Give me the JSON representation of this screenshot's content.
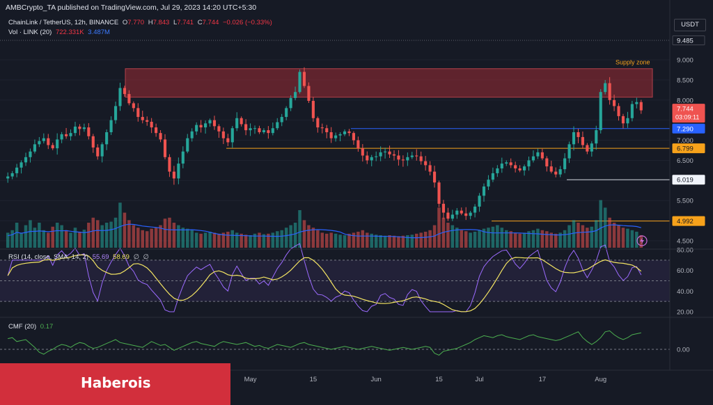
{
  "header": {
    "publisher": "AMBCrypto_TA published on TradingView.com, Jul 29, 2023 14:20 UTC+5:30",
    "symbol": "ChainLink / TetherUS, 12h, BINANCE",
    "ohlc": {
      "open_label": "O",
      "open": "7.770",
      "high_label": "H",
      "high": "7.843",
      "low_label": "L",
      "low": "7.741",
      "close_label": "C",
      "close": "7.744",
      "change": "−0.026 (−0.33%)"
    },
    "volume_legend": {
      "label": "Vol · LINK (20)",
      "value": "722.331K",
      "ma": "3.487M"
    },
    "currency": "USDT"
  },
  "rsi_legend": {
    "label": "RSI (14, close, SMA, 14, 2)",
    "rsi": "55.69",
    "sma": "58.69",
    "extra1": "∅",
    "extra2": "∅"
  },
  "cmf_legend": {
    "label": "CMF (20)",
    "value": "0.17"
  },
  "watermark": "Haberois",
  "colors": {
    "background": "#161a25",
    "up": "#26a69a",
    "down": "#ef5350",
    "supply_zone": "#9c2c35",
    "level_blue": "#2962ff",
    "level_orange": "#f7a21b",
    "level_white": "#d1d4dc",
    "rsi_line": "#9c6bff",
    "rsi_sma": "#f5e663",
    "cmf_line": "#4caf50",
    "volume_ma": "#2962ff",
    "watermark_bar": "#d22f3c"
  },
  "chart_data": [
    {
      "type": "candlestick",
      "title": "ChainLink / TetherUS, 12h, BINANCE",
      "interval": "12h",
      "ylim": [
        4.38,
        9.6
      ],
      "y_ticks": [
        "9.000",
        "8.500",
        "8.000",
        "7.500",
        "7.000",
        "6.500",
        "6.000",
        "5.500",
        "5.000",
        "4.500"
      ],
      "x_ticks": [
        "Apr",
        "17",
        "May",
        "15",
        "Jun",
        "15",
        "Jul",
        "17",
        "Aug"
      ],
      "price_labels": [
        {
          "value": "9.485",
          "style": "plain"
        },
        {
          "value": "7.744",
          "countdown": "03:09:11",
          "style": "last-price"
        },
        {
          "value": "7.290",
          "style": "blue"
        },
        {
          "value": "6.799",
          "style": "orange"
        },
        {
          "value": "6.019",
          "style": "white"
        },
        {
          "value": "4.992",
          "style": "orange"
        }
      ],
      "supply_zone": {
        "label": "Supply zone",
        "low": 8.07,
        "high": 8.78
      },
      "levels": [
        {
          "value": 7.29,
          "color": "blue"
        },
        {
          "value": 6.799,
          "color": "orange"
        },
        {
          "value": 6.019,
          "color": "white"
        },
        {
          "value": 4.992,
          "color": "orange"
        }
      ],
      "close_path": [
        6.1,
        6.18,
        6.32,
        6.45,
        6.58,
        6.72,
        6.9,
        6.98,
        7.05,
        6.88,
        6.8,
        7.02,
        7.15,
        7.1,
        7.18,
        7.34,
        7.28,
        7.32,
        7.1,
        6.82,
        6.6,
        6.9,
        7.2,
        7.5,
        7.85,
        8.3,
        8.15,
        7.92,
        7.8,
        7.58,
        7.5,
        7.46,
        7.32,
        7.18,
        7.02,
        6.58,
        6.22,
        6.05,
        6.42,
        6.72,
        7.05,
        7.22,
        7.38,
        7.32,
        7.42,
        7.5,
        7.35,
        7.22,
        7.05,
        6.95,
        7.3,
        7.55,
        7.4,
        7.25,
        7.3,
        7.3,
        7.2,
        7.25,
        7.18,
        7.3,
        7.45,
        7.58,
        7.8,
        8.05,
        8.2,
        8.7,
        8.35,
        7.98,
        7.55,
        7.32,
        7.3,
        7.2,
        7.05,
        7.12,
        7.15,
        7.22,
        7.18,
        7.0,
        6.8,
        6.62,
        6.5,
        6.58,
        6.6,
        6.7,
        6.72,
        6.65,
        6.62,
        6.52,
        6.5,
        6.58,
        6.62,
        6.6,
        6.48,
        6.38,
        6.22,
        5.95,
        5.42,
        5.2,
        5.05,
        5.15,
        5.25,
        5.18,
        5.12,
        5.2,
        5.35,
        5.62,
        5.85,
        6.02,
        6.18,
        6.3,
        6.42,
        6.45,
        6.38,
        6.3,
        6.25,
        6.35,
        6.5,
        6.6,
        6.7,
        6.55,
        6.35,
        6.22,
        6.15,
        6.28,
        6.55,
        6.9,
        7.2,
        7.08,
        6.88,
        6.72,
        6.92,
        7.25,
        8.2,
        8.42,
        8.0,
        7.85,
        7.6,
        7.42,
        7.55,
        7.9,
        7.95,
        7.744
      ]
    },
    {
      "type": "bar",
      "title": "Vol · LINK (20)",
      "last_value": "722.331K",
      "ma_value": "3.487M",
      "relative_volume": [
        0.3,
        0.35,
        0.5,
        0.3,
        0.45,
        0.55,
        0.4,
        0.5,
        0.35,
        0.3,
        0.42,
        0.5,
        0.45,
        0.35,
        0.3,
        0.4,
        0.32,
        0.36,
        0.5,
        0.6,
        0.55,
        0.45,
        0.5,
        0.52,
        0.6,
        0.9,
        0.7,
        0.55,
        0.45,
        0.4,
        0.35,
        0.33,
        0.38,
        0.4,
        0.45,
        0.58,
        0.6,
        0.5,
        0.45,
        0.4,
        0.38,
        0.35,
        0.3,
        0.28,
        0.3,
        0.32,
        0.3,
        0.28,
        0.3,
        0.32,
        0.35,
        0.3,
        0.28,
        0.26,
        0.25,
        0.28,
        0.3,
        0.27,
        0.28,
        0.3,
        0.33,
        0.35,
        0.4,
        0.45,
        0.5,
        0.75,
        0.55,
        0.45,
        0.4,
        0.35,
        0.3,
        0.28,
        0.3,
        0.28,
        0.26,
        0.25,
        0.28,
        0.3,
        0.32,
        0.35,
        0.3,
        0.28,
        0.26,
        0.25,
        0.24,
        0.25,
        0.24,
        0.23,
        0.24,
        0.25,
        0.26,
        0.28,
        0.3,
        0.32,
        0.35,
        0.45,
        0.8,
        0.6,
        0.5,
        0.45,
        0.4,
        0.35,
        0.33,
        0.3,
        0.32,
        0.35,
        0.38,
        0.4,
        0.42,
        0.45,
        0.4,
        0.35,
        0.33,
        0.3,
        0.28,
        0.3,
        0.33,
        0.35,
        0.38,
        0.35,
        0.33,
        0.3,
        0.28,
        0.3,
        0.35,
        0.45,
        0.55,
        0.5,
        0.45,
        0.4,
        0.42,
        0.55,
        0.95,
        0.8,
        0.6,
        0.5,
        0.45,
        0.4,
        0.38,
        0.35,
        0.32,
        0.25
      ]
    },
    {
      "type": "line",
      "title": "RSI (14, close, SMA, 14, 2)",
      "ylim": [
        14,
        88
      ],
      "y_ticks": [
        "80.00",
        "60.00",
        "40.00",
        "20.00"
      ],
      "bands": {
        "upper": 70,
        "middle": 50,
        "lower": 30
      },
      "series": [
        {
          "name": "RSI",
          "last_value": "55.69"
        },
        {
          "name": "SMA",
          "last_value": "58.69"
        }
      ]
    },
    {
      "type": "line",
      "title": "CMF (20)",
      "ylim": [
        -0.18,
        0.28
      ],
      "y_ticks": [
        "0.00"
      ],
      "series": [
        {
          "name": "CMF",
          "last_value": "0.17",
          "values": [
            0.11,
            0.12,
            0.08,
            0.09,
            0.1,
            0.06,
            0.02,
            -0.03,
            -0.05,
            -0.02,
            0.0,
            0.03,
            0.05,
            0.04,
            0.02,
            0.05,
            0.07,
            0.06,
            0.03,
            0.01,
            0.02,
            0.04,
            0.06,
            0.08,
            0.1,
            0.07,
            0.06,
            0.05,
            0.04,
            0.03,
            0.02,
            0.05,
            0.08,
            0.06,
            0.04,
            0.05,
            0.02,
            -0.01,
            0.01,
            0.03,
            0.05,
            0.07,
            0.08,
            0.06,
            0.05,
            0.04,
            0.03,
            0.06,
            0.08,
            0.07,
            0.06,
            0.05,
            0.06,
            0.07,
            0.05,
            0.03,
            0.04,
            0.02,
            0.01,
            0.03,
            0.05,
            0.04,
            0.03,
            0.02,
            0.04,
            0.06,
            0.07,
            0.05,
            0.04,
            0.03,
            0.02,
            0.01,
            0.0,
            0.01,
            0.02,
            0.03,
            0.02,
            0.01,
            0.0,
            0.01,
            0.02,
            0.03,
            0.02,
            0.01,
            0.0,
            -0.01,
            0.0,
            0.01,
            0.02,
            0.01,
            0.0,
            0.01,
            0.02,
            0.03,
            0.02,
            -0.04,
            -0.06,
            -0.02,
            -0.01,
            0.0,
            0.01,
            0.03,
            0.05,
            0.07,
            0.1,
            0.12,
            0.14,
            0.13,
            0.12,
            0.14,
            0.15,
            0.13,
            0.12,
            0.11,
            0.1,
            0.12,
            0.14,
            0.15,
            0.13,
            0.12,
            0.11,
            0.1,
            0.09,
            0.1,
            0.12,
            0.14,
            0.16,
            0.18,
            0.12,
            0.08,
            0.05,
            0.08,
            0.12,
            0.18,
            0.19,
            0.15,
            0.12,
            0.1,
            0.12,
            0.15,
            0.16,
            0.17
          ]
        }
      ]
    }
  ]
}
